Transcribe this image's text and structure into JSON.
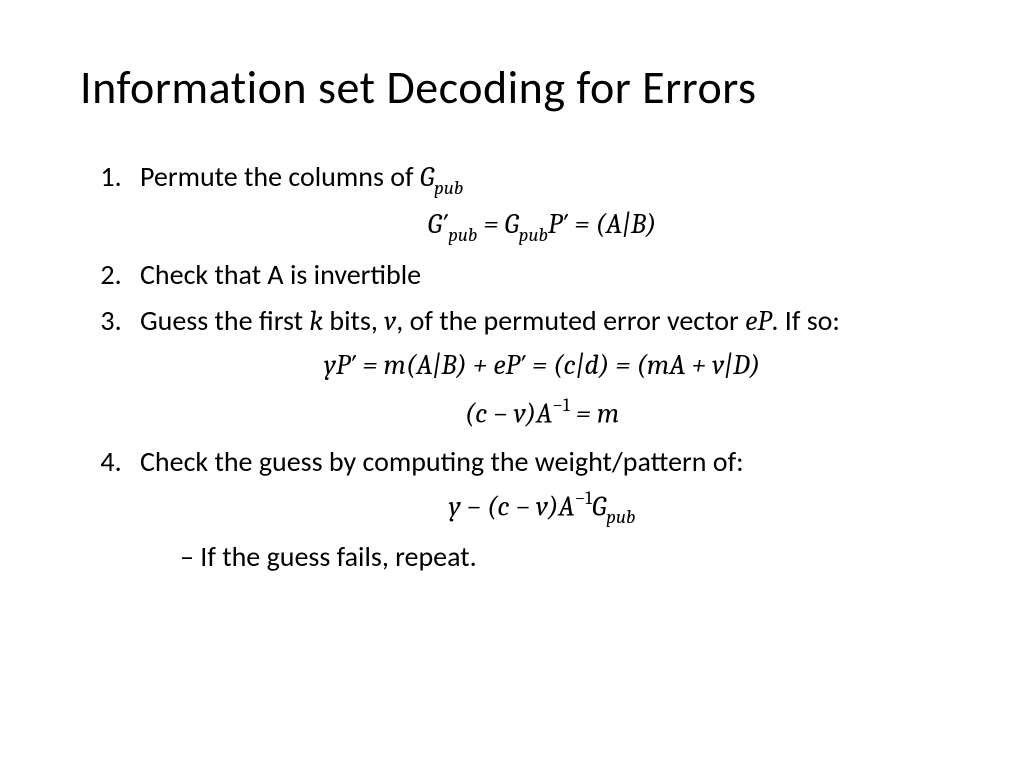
{
  "title": "Information set Decoding for Errors",
  "items": {
    "item1": {
      "text_before": "Permute the columns of ",
      "math1": "G",
      "math1_sub": "pub",
      "eq_lhs1": "G′",
      "eq_sub1": "pub",
      "eq_mid": " = G",
      "eq_sub2": "pub",
      "eq_rhs": "P′ = (A|B)"
    },
    "item2": {
      "text": "Check that A is invertible"
    },
    "item3": {
      "text_a": "Guess the first ",
      "math_k": "k",
      "text_b": " bits, ",
      "math_v": "v",
      "text_c": ", of the permuted error vector ",
      "math_eP": "eP",
      "text_d": ". If so:",
      "eq1": "yP′ = m(A|B) + eP′ = (c|d) = (mA + v|D)",
      "eq2_a": "(c − v)A",
      "eq2_sup": "−1",
      "eq2_b": " = m"
    },
    "item4": {
      "text": "Check the guess by computing the weight/pattern of:",
      "eq_a": "y − (c − v)A",
      "eq_sup": "−1",
      "eq_g": "G",
      "eq_sub": "pub",
      "dash": "If the guess fails, repeat."
    }
  }
}
